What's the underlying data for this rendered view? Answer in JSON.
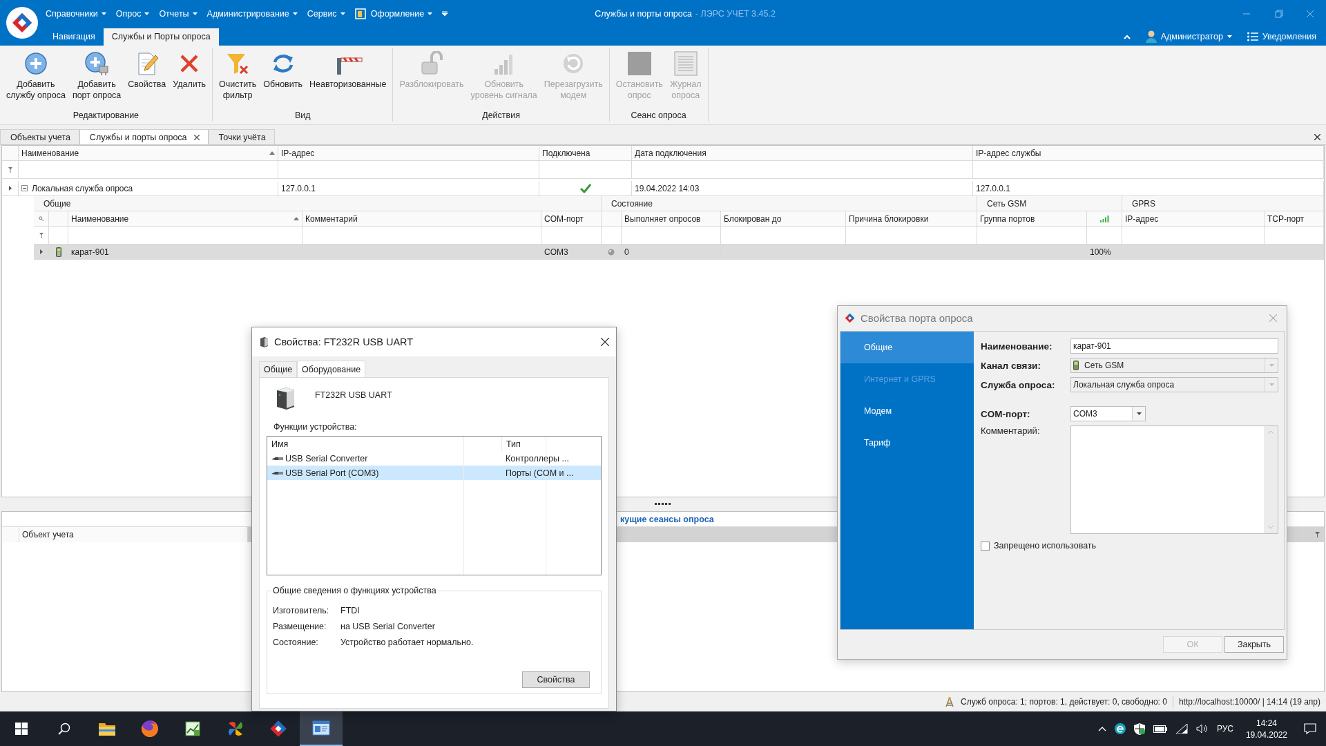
{
  "titlebar": {
    "title": "Службы и порты опроса",
    "product": "- ЛЭРС УЧЕТ 3.45.2"
  },
  "menu": [
    {
      "label": "Справочники",
      "dropdown": true
    },
    {
      "label": "Опрос",
      "dropdown": true
    },
    {
      "label": "Отчеты",
      "dropdown": true
    },
    {
      "label": "Администрирование",
      "dropdown": true
    },
    {
      "label": "Сервис",
      "dropdown": true
    },
    {
      "label": "Оформление",
      "dropdown": true,
      "kind": "icon"
    }
  ],
  "ribbon_tabs": [
    {
      "label": "Навигация",
      "selected": false
    },
    {
      "label": "Службы и Порты опроса",
      "selected": true
    }
  ],
  "user": {
    "name": "Администратор"
  },
  "notifications": {
    "label": "Уведомления"
  },
  "ribbon_groups": [
    {
      "label": "Редактирование",
      "buttons": [
        {
          "kind": "add",
          "label": "Добавить\nслужбу опроса",
          "disabled": false
        },
        {
          "kind": "add-port",
          "label": "Добавить\nпорт опроса",
          "disabled": false
        },
        {
          "kind": "properties",
          "label": "Свойства",
          "disabled": false
        },
        {
          "kind": "delete",
          "label": "Удалить",
          "disabled": false
        }
      ]
    },
    {
      "label": "Вид",
      "buttons": [
        {
          "kind": "clear-filter",
          "label": "Очистить\nфильтр",
          "disabled": false
        },
        {
          "kind": "refresh",
          "label": "Обновить",
          "disabled": false
        },
        {
          "kind": "barrier",
          "label": "Неавторизованные",
          "disabled": false
        }
      ]
    },
    {
      "label": "Действия",
      "buttons": [
        {
          "kind": "unlock",
          "label": "Разблокировать",
          "disabled": true
        },
        {
          "kind": "signal",
          "label": "Обновить\nуровень сигнала",
          "disabled": true
        },
        {
          "kind": "restart",
          "label": "Перезагрузить\nмодем",
          "disabled": true
        }
      ]
    },
    {
      "label": "Сеанс опроса",
      "buttons": [
        {
          "kind": "stop",
          "label": "Остановить\nопрос",
          "disabled": true
        },
        {
          "kind": "log",
          "label": "Журнал\nопроса",
          "disabled": true
        }
      ]
    }
  ],
  "document_tabs": [
    {
      "label": "Объекты учета",
      "selected": false,
      "closable": false
    },
    {
      "label": "Службы и порты опроса",
      "selected": true,
      "closable": true
    },
    {
      "label": "Точки учёта",
      "selected": false,
      "closable": false
    }
  ],
  "services_grid": {
    "columns": [
      {
        "label": "Наименование",
        "sorted": true
      },
      {
        "label": "IP-адрес"
      },
      {
        "label": "Подключена"
      },
      {
        "label": "Дата подключения"
      },
      {
        "label": "IP-адрес службы"
      }
    ],
    "rows": [
      {
        "expanded": true,
        "name": "Локальная служба опроса",
        "ip": "127.0.0.1",
        "connected": true,
        "date": "19.04.2022 14:03",
        "service_ip": "127.0.0.1",
        "ports": {
          "groups": [
            {
              "label": "Общие"
            },
            {
              "label": "Состояние"
            },
            {
              "label": "Сеть GSM"
            },
            {
              "label": "GPRS"
            }
          ],
          "columns": [
            {
              "label": "Наименование",
              "sorted": true
            },
            {
              "label": "Комментарий"
            },
            {
              "label": "COM-порт"
            },
            {
              "label": "Выполняет опросов"
            },
            {
              "label": "Блокирован до"
            },
            {
              "label": "Причина блокировки"
            },
            {
              "label": "Группа портов"
            },
            {
              "label": "IP-адрес"
            },
            {
              "label": "TCP-порт"
            }
          ],
          "rows": [
            {
              "selected": true,
              "name": "карат-901",
              "com_port": "COM3",
              "active": false,
              "polls": "0",
              "signal": "100%"
            }
          ]
        }
      }
    ]
  },
  "sessions_panel": {
    "title": "кущие сеансы опроса",
    "columns": [
      {
        "label": "Объект учета"
      }
    ]
  },
  "status_bar": {
    "summary": "Служб опроса: 1; портов: 1, действует: 0, свободно: 0",
    "server": "http://localhost:10000/ | 14:14 (19 апр)"
  },
  "device_dialog": {
    "title": "Свойства: FT232R USB UART",
    "tabs": [
      {
        "label": "Общие",
        "selected": false
      },
      {
        "label": "Оборудование",
        "selected": true
      }
    ],
    "device": "FT232R USB UART",
    "functions_label": "Функции устройства:",
    "columns": [
      {
        "label": "Имя"
      },
      {
        "label": "Тип"
      }
    ],
    "functions": [
      {
        "name": "USB Serial Converter",
        "type": "Контроллеры ...",
        "selected": false
      },
      {
        "name": "USB Serial Port (COM3)",
        "type": "Порты (COM и ...",
        "selected": true
      }
    ],
    "summary": {
      "title": "Общие сведения о функциях устройства",
      "fields": [
        {
          "label": "Изготовитель:",
          "value": "FTDI"
        },
        {
          "label": "Размещение:",
          "value": "на USB Serial Converter"
        },
        {
          "label": "Состояние:",
          "value": "Устройство работает нормально."
        }
      ]
    },
    "button": "Свойства"
  },
  "port_dialog": {
    "title": "Свойства порта опроса",
    "nav": [
      {
        "label": "Общие",
        "selected": true,
        "disabled": false
      },
      {
        "label": "Интернет и GPRS",
        "selected": false,
        "disabled": true
      },
      {
        "label": "Модем",
        "selected": false,
        "disabled": false
      },
      {
        "label": "Тариф",
        "selected": false,
        "disabled": false
      }
    ],
    "fields": [
      {
        "kind": "text",
        "label": "Наименование:",
        "value": "карат-901",
        "required": true
      },
      {
        "kind": "combo",
        "label": "Канал связи:",
        "value": "Сеть GSM",
        "required": true,
        "icon": true
      },
      {
        "kind": "combo",
        "label": "Служба опроса:",
        "value": "Локальная служба опроса",
        "required": true
      },
      {
        "kind": "dropdown",
        "label": "COM-порт:",
        "value": "COM3",
        "required": true
      },
      {
        "kind": "textarea",
        "label": "Комментарий:",
        "required": false
      }
    ],
    "checkbox": {
      "label": "Запрещено использовать",
      "checked": false
    },
    "buttons": [
      {
        "label": "ОК",
        "disabled": true
      },
      {
        "label": "Закрыть",
        "disabled": false
      }
    ]
  },
  "taskbar": {
    "apps": [
      {
        "kind": "folder",
        "selected": false
      },
      {
        "kind": "browser",
        "selected": false
      },
      {
        "kind": "chart",
        "selected": false
      },
      {
        "kind": "pinwheel",
        "selected": false
      },
      {
        "kind": "diamond",
        "selected": false
      },
      {
        "kind": "window",
        "selected": true
      }
    ],
    "language": "РУС",
    "time": "14:24",
    "date": "19.04.2022"
  }
}
